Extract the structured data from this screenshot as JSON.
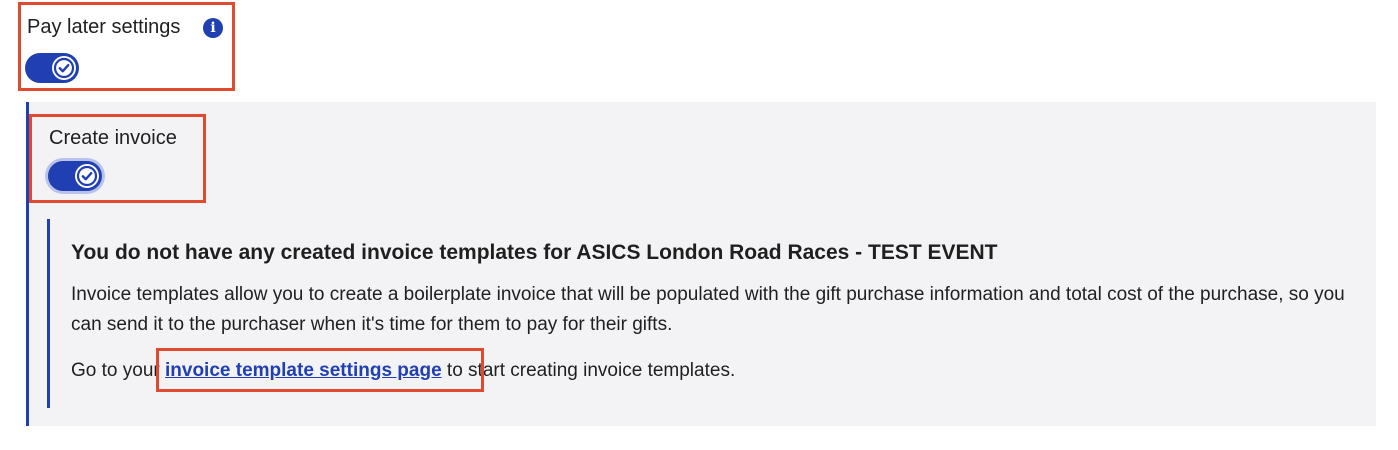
{
  "pay_later": {
    "label": "Pay later settings",
    "info_icon": "info-icon",
    "toggle_on": true
  },
  "create_invoice": {
    "label": "Create invoice",
    "toggle_on": true
  },
  "notice": {
    "title": "You do not have any created invoice templates for ASICS London Road Races - TEST EVENT",
    "body": "Invoice templates allow you to create a boilerplate invoice that will be populated with the gift purchase information and total cost of the purchase, so you can send it to the purchaser when it's time for them to pay for their gifts.",
    "cta_prefix": "Go to your ",
    "cta_link": "invoice template settings page",
    "cta_suffix": " to start creating invoice templates."
  },
  "colors": {
    "accent": "#1f3fb3",
    "highlight": "#e04a2f",
    "panel_bg": "#f3f3f6"
  }
}
